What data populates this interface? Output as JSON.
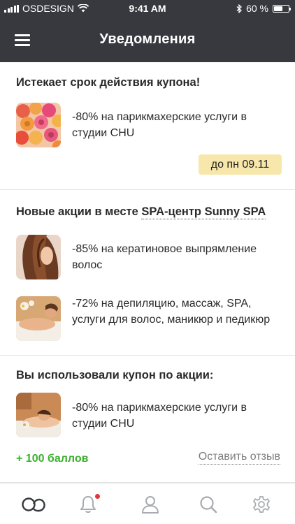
{
  "status_bar": {
    "carrier": "OSDESIGN",
    "time": "9:41 AM",
    "battery_text": "60 %"
  },
  "header": {
    "title": "Уведомления"
  },
  "notifications": [
    {
      "title": "Истекает срок действия купона!",
      "items": [
        {
          "text": "-80% на парикмахерские услуги в студии CHU",
          "image": "roses-photo"
        }
      ],
      "badge": "до пн 09.11"
    },
    {
      "title_prefix": "Новые акции в месте ",
      "title_link": "SPA-центр Sunny SPA",
      "items": [
        {
          "text": "-85% на кератиновое выпрямление волос",
          "image": "hair-photo"
        },
        {
          "text": "-72% на депиляцию, массаж, SPA, услуги для волос, маникюр и педикюр",
          "image": "spa-photo"
        }
      ]
    },
    {
      "title": "Вы использовали купон по акции:",
      "items": [
        {
          "text": "-80% на парикмахерские услуги в студии CHU",
          "image": "massage-photo"
        }
      ],
      "points": "+ 100 баллов",
      "action": "Оставить отзыв"
    }
  ],
  "tab_bar": {
    "tabs": [
      "home-logo-icon",
      "bell-icon",
      "user-icon",
      "search-icon",
      "gear-icon"
    ],
    "active_color": "#37393f",
    "inactive_color": "#a9abb0",
    "badge_color": "#e6343a"
  },
  "colors": {
    "header_bg": "#37393f",
    "date_badge_bg": "#f8e7ab",
    "points_green": "#3bb12e"
  }
}
